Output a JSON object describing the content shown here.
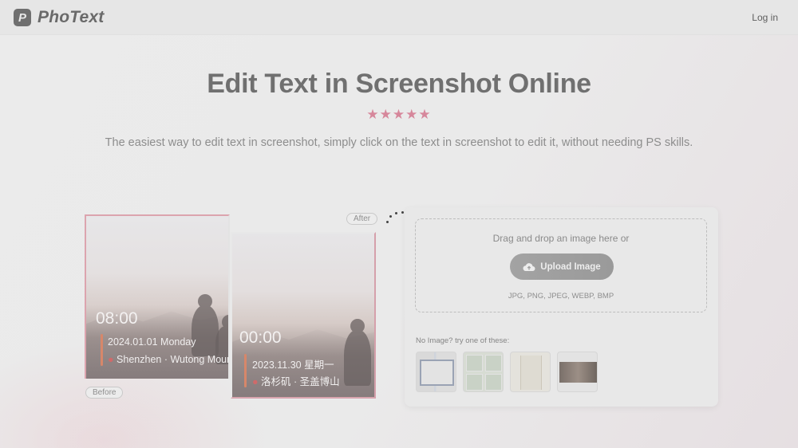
{
  "header": {
    "logo_glyph": "P",
    "brand": "PhoText",
    "login_label": "Log in"
  },
  "hero": {
    "title": "Edit Text in Screenshot Online",
    "stars": "★★★★★",
    "rating": 5,
    "subtitle": "The easiest way to edit text in screenshot, simply click on the text in screenshot to edit it, without needing PS skills."
  },
  "demo": {
    "before": {
      "tag": "Before",
      "time": "08:00",
      "date": "2024.01.01 Monday",
      "location": "Shenzhen · Wutong Moun"
    },
    "after": {
      "tag": "After",
      "time": "00:00",
      "date": "2023.11.30 星期一",
      "location": "洛杉矶 · 圣盖博山"
    }
  },
  "upload": {
    "drop_text": "Drag and drop an image here or",
    "button_label": "Upload Image",
    "button_icon": "cloud-upload-icon",
    "formats": "JPG, PNG, JPEG, WEBP, BMP",
    "try_text": "No Image? try one of these:",
    "samples": [
      "sample-document",
      "sample-collage",
      "sample-card",
      "sample-photo"
    ]
  },
  "colors": {
    "accent_pink": "#d6879b",
    "stars": "#d6879b",
    "button": "#9e9e9e"
  }
}
